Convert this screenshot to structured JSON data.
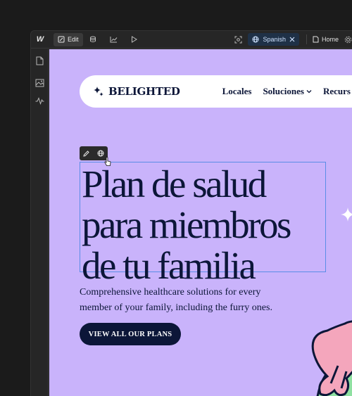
{
  "toolbar": {
    "logo": "W",
    "edit_label": "Edit",
    "language": "Spanish",
    "page": "Home"
  },
  "site": {
    "brand": "BELIGHTED",
    "nav": [
      "Locales",
      "Soluciones",
      "Recurs"
    ],
    "hero_title": [
      "Plan de salud",
      "para miembros",
      "de tu familia"
    ],
    "hero_subtitle": [
      "Comprehensive healthcare solutions for every",
      "member of your family, including the furry ones."
    ],
    "cta_label": "VIEW ALL OUR PLANS"
  },
  "colors": {
    "canvas_bg": "#c9b3fb",
    "navy": "#0c1638",
    "selection": "#5a8de6",
    "editor_bg": "#262626"
  }
}
